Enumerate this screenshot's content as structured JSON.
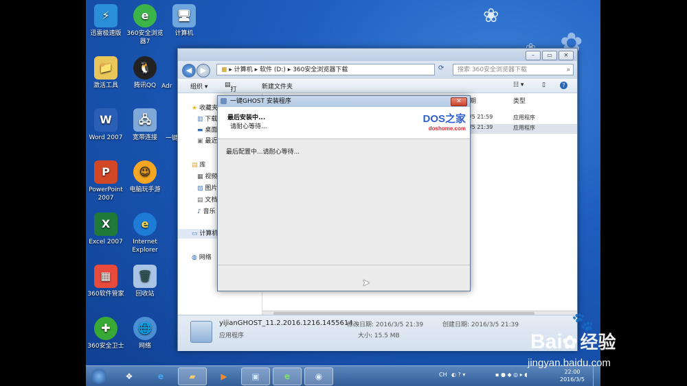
{
  "desktop": {
    "icons": [
      {
        "label": "迅雷极速版",
        "glyph": "⚡"
      },
      {
        "label": "360安全浏览器7",
        "glyph": "e"
      },
      {
        "label": "计算机",
        "glyph": "🖥"
      },
      {
        "label": "激活工具",
        "glyph": "📁"
      },
      {
        "label": "腾讯QQ",
        "glyph": "🐧"
      },
      {
        "label": "Word 2007",
        "glyph": "W"
      },
      {
        "label": "宽带连接",
        "glyph": "🖧"
      },
      {
        "label": "PowerPoint 2007",
        "glyph": "P"
      },
      {
        "label": "电脑玩手游",
        "glyph": "☺"
      },
      {
        "label": "Excel 2007",
        "glyph": "X"
      },
      {
        "label": "Internet Explorer",
        "glyph": "e"
      },
      {
        "label": "360软件管家",
        "glyph": "▦"
      },
      {
        "label": "回收站",
        "glyph": "🗑"
      },
      {
        "label": "360安全卫士",
        "glyph": "✚"
      },
      {
        "label": "网络",
        "glyph": "🌐"
      }
    ],
    "partial_labels": [
      "Adr",
      "一键"
    ]
  },
  "explorer": {
    "address_parts": [
      "计算机",
      "软件 (D:)",
      "360安全浏览器下载"
    ],
    "search_placeholder": "搜索 360安全浏览器下载",
    "toolbar": {
      "organize": "组织 ▾",
      "open": "打开",
      "new_folder": "新建文件夹"
    },
    "nav": {
      "favorites": "收藏夹",
      "fav_items": [
        "下载",
        "桌面",
        "最近"
      ],
      "libraries": "库",
      "lib_items": [
        "视频",
        "图片",
        "文档",
        "音乐"
      ],
      "computer": "计算机",
      "network": "网络"
    },
    "columns": {
      "date": "期",
      "type": "类型"
    },
    "rows": [
      {
        "date": "/5 21:59",
        "type": "应用程序"
      },
      {
        "date": "/5 21:39",
        "type": "应用程序"
      }
    ],
    "details": {
      "filename": "yijianGHOST_11.2.2016.1216.1455614...",
      "modified": "修改日期: 2016/3/5 21:39",
      "created": "创建日期: 2016/3/5 21:39",
      "kind": "应用程序",
      "size": "大小: 15.5 MB"
    }
  },
  "dialog": {
    "title": "一键GHOST 安装程序",
    "heading": "最后安装中...",
    "subheading": "请耐心等待...",
    "brand_main": "DOS之家",
    "brand_url": "doshome.com",
    "body_text": "最后配置中...请耐心等待..."
  },
  "taskbar": {
    "ime": "CH",
    "time": "22:00",
    "date": "2016/3/5"
  },
  "watermark": {
    "brand": "Bai",
    "brand2": "经验",
    "url": "jingyan.baidu.com"
  }
}
